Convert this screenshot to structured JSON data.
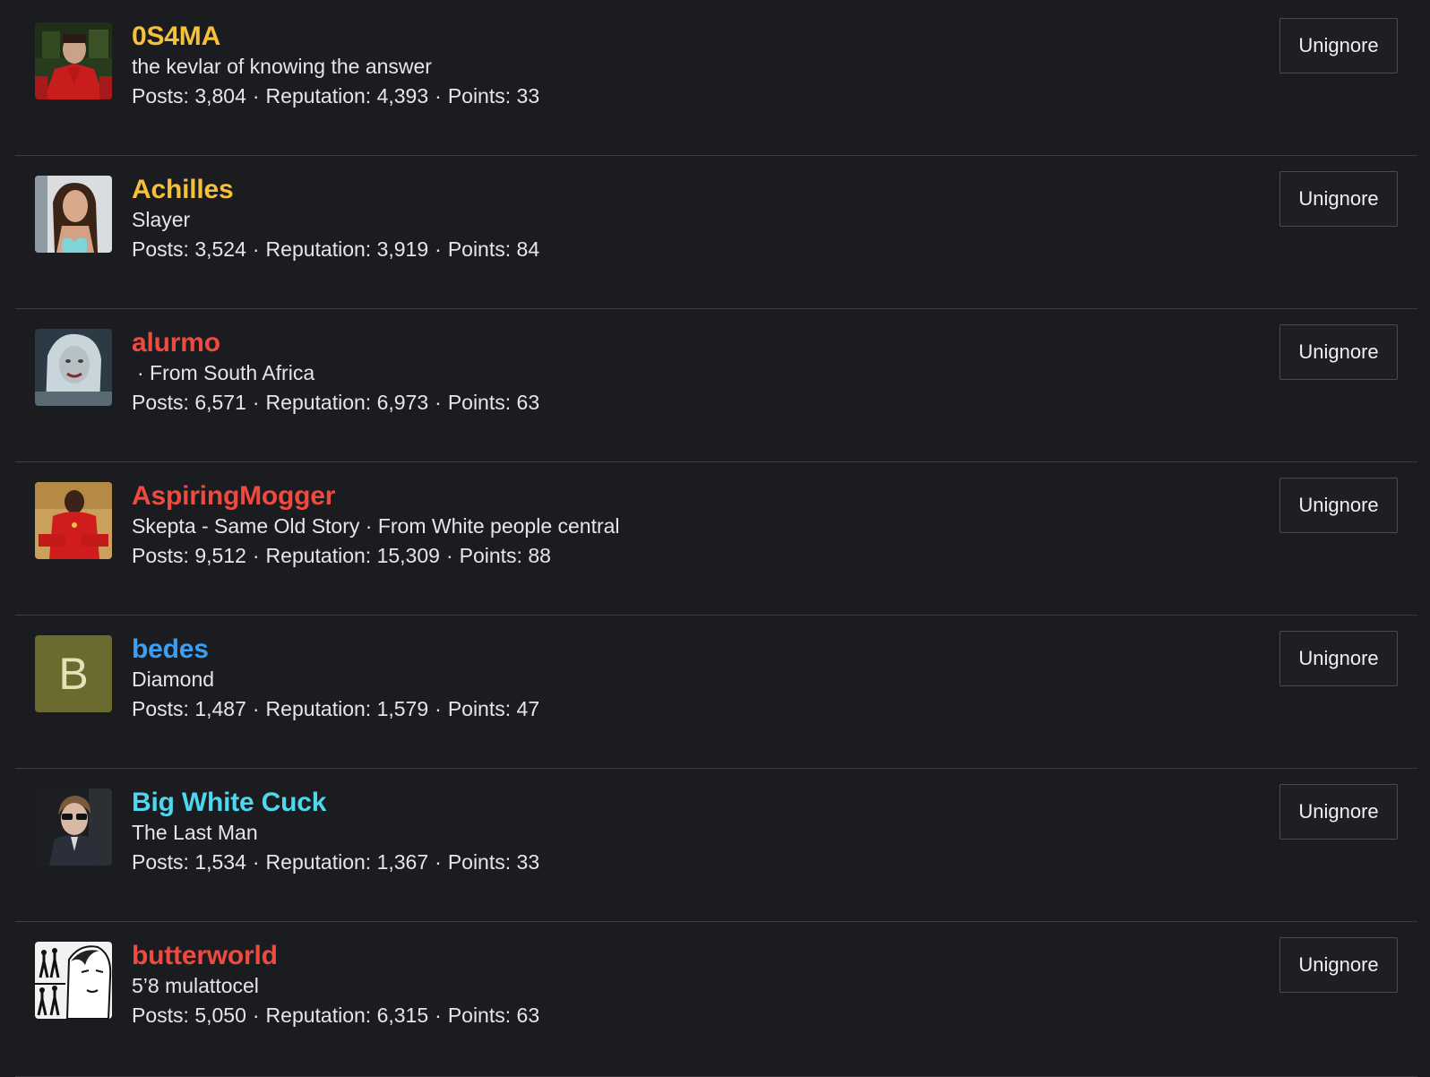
{
  "colors": {
    "background": "#1b1c1f",
    "divider": "#3b3c40",
    "text": "#e6e6e6",
    "gold": "#f5c03a",
    "red": "#ef4a3f",
    "blue": "#3ba0f5",
    "cyan": "#4dd8f0",
    "letter_avatar_bg": "#6c6b2f"
  },
  "separator": "·",
  "labels": {
    "posts": "Posts:",
    "reputation": "Reputation:",
    "points": "Points:"
  },
  "users": [
    {
      "username": "0S4MA",
      "username_color": "#f5c03a",
      "title": "the kevlar of knowing the answer",
      "posts": "3,804",
      "reputation": "4,393",
      "points": "33",
      "button": "Unignore",
      "avatar_icon": "red-jumpsuit-portrait"
    },
    {
      "username": "Achilles",
      "username_color": "#f5c03a",
      "title": "Slayer",
      "posts": "3,524",
      "reputation": "3,919",
      "points": "84",
      "button": "Unignore",
      "avatar_icon": "woman-portrait"
    },
    {
      "username": "alurmo",
      "username_color": "#ef4a3f",
      "title": "· From South Africa",
      "posts": "6,571",
      "reputation": "6,973",
      "points": "63",
      "button": "Unignore",
      "avatar_icon": "blonde-woman-portrait"
    },
    {
      "username": "AspiringMogger",
      "username_color": "#ef4a3f",
      "title": "Skepta - Same Old Story · From White people central",
      "posts": "9,512",
      "reputation": "15,309",
      "points": "88",
      "button": "Unignore",
      "avatar_icon": "man-in-red-portrait"
    },
    {
      "username": "bedes",
      "username_color": "#3ba0f5",
      "title": "Diamond",
      "posts": "1,487",
      "reputation": "1,579",
      "points": "47",
      "button": "Unignore",
      "avatar_letter": "B"
    },
    {
      "username": "Big White Cuck",
      "username_color": "#4dd8f0",
      "title": "The Last Man",
      "posts": "1,534",
      "reputation": "1,367",
      "points": "33",
      "button": "Unignore",
      "avatar_icon": "man-sunglasses-portrait"
    },
    {
      "username": "butterworld",
      "username_color": "#ef4a3f",
      "title": "5’8 mulattocel",
      "posts": "5,050",
      "reputation": "6,315",
      "points": "63",
      "button": "Unignore",
      "avatar_icon": "manga-evolution-portrait"
    }
  ]
}
